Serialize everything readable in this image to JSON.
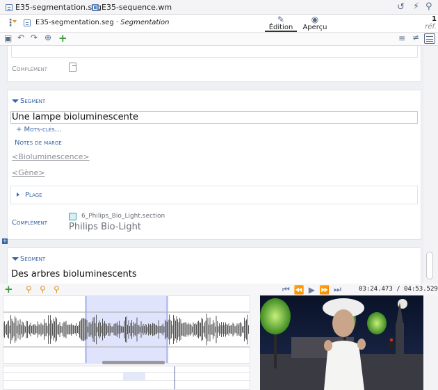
{
  "tabs": [
    {
      "label": "E35-segmentation.seg",
      "icon": "document-icon"
    },
    {
      "label": "E35-sequence.wm",
      "icon": "media-file-icon"
    }
  ],
  "header": {
    "doc_title": "E35-segmentation.seg",
    "separator": " · ",
    "doc_type": "Segmentation",
    "edition_label": "Édition",
    "apercu_label": "Aperçu",
    "ref_count": "1",
    "ref_label": "réf."
  },
  "editor": {
    "top_card": {
      "complement_label": "Complément"
    },
    "segment1": {
      "label": "Segment",
      "title": "Une lampe bioluminescente",
      "keywords_label": "+ Mots-clés...",
      "notes_label": "Notes de marge",
      "link1": "<Bioluminescence>",
      "link2": "<Gène>",
      "plage_label": "Plage",
      "complement_label": "Complément",
      "section_file": "6_Philips_Bio_Light.section",
      "section_title": "Philips Bio-Light"
    },
    "segment2": {
      "label": "Segment",
      "title": "Des arbres bioluminescents"
    }
  },
  "player": {
    "time_current": "03:24.473",
    "time_sep": " / ",
    "time_total": "04:53.529"
  },
  "colors": {
    "accent": "#3464a6",
    "selection": "#dfe3fb",
    "waveform": "#555555"
  }
}
